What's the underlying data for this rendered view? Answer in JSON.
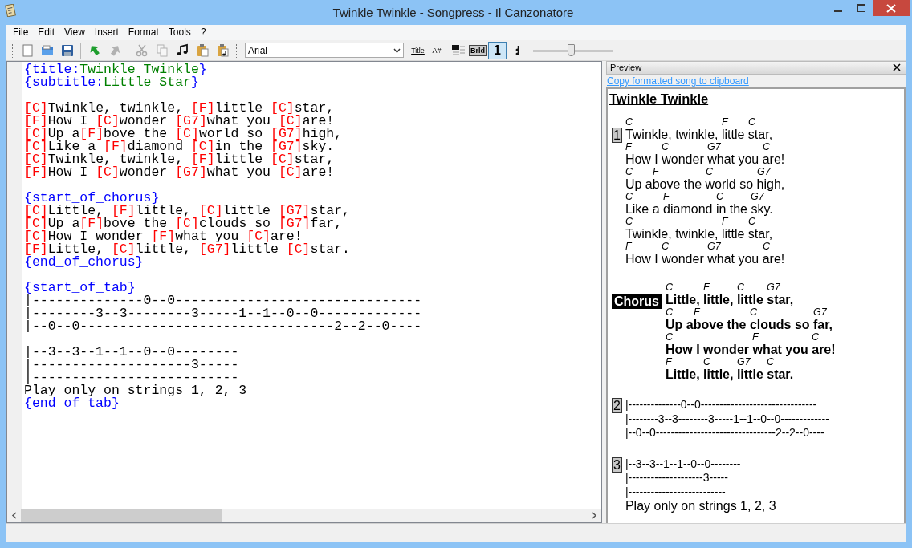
{
  "window": {
    "title": "Twinkle Twinkle - Songpress - Il Canzonatore"
  },
  "menu": [
    "File",
    "Edit",
    "View",
    "Insert",
    "Format",
    "Tools",
    "?"
  ],
  "toolbar": {
    "file_tools": [
      {
        "disabled": false
      },
      {
        "disabled": false
      },
      {
        "disabled": false
      }
    ],
    "edit_tools": [
      {
        "disabled": false
      },
      {
        "disabled": true
      },
      {
        "disabled": true
      },
      {
        "disabled": true
      },
      {
        "disabled": false
      },
      {
        "disabled": false
      },
      {
        "disabled": false
      }
    ],
    "font_field": {
      "value": "Arial"
    },
    "format_tools": [
      {
        "label": "Title",
        "disabled": false,
        "selected": false
      },
      {
        "label": "A#-",
        "disabled": false,
        "selected": false
      },
      {
        "disabled": false,
        "selected": false
      },
      {
        "label": "Brld",
        "disabled": false,
        "selected": false
      },
      {
        "label": "1",
        "disabled": false,
        "selected": true
      },
      {
        "disabled": false,
        "selected": false
      }
    ],
    "zoom": {
      "level": 0.47
    }
  },
  "editor": {
    "blocks": [
      [
        [
          {
            "kind": "directive",
            "text": "{title:"
          },
          {
            "kind": "value",
            "text": "Twinkle Twinkle"
          },
          {
            "kind": "directive",
            "text": "}"
          }
        ],
        [
          {
            "kind": "directive",
            "text": "{subtitle:"
          },
          {
            "kind": "value",
            "text": "Little Star"
          },
          {
            "kind": "directive",
            "text": "}"
          }
        ]
      ],
      [
        [
          {
            "kind": "chord",
            "text": "[C]"
          },
          {
            "kind": "text",
            "text": "Twinkle, twinkle, "
          },
          {
            "kind": "chord",
            "text": "[F]"
          },
          {
            "kind": "text",
            "text": "little "
          },
          {
            "kind": "chord",
            "text": "[C]"
          },
          {
            "kind": "text",
            "text": "star,"
          }
        ],
        [
          {
            "kind": "chord",
            "text": "[F]"
          },
          {
            "kind": "text",
            "text": "How I "
          },
          {
            "kind": "chord",
            "text": "[C]"
          },
          {
            "kind": "text",
            "text": "wonder "
          },
          {
            "kind": "chord",
            "text": "[G7]"
          },
          {
            "kind": "text",
            "text": "what you "
          },
          {
            "kind": "chord",
            "text": "[C]"
          },
          {
            "kind": "text",
            "text": "are!"
          }
        ],
        [
          {
            "kind": "chord",
            "text": "[C]"
          },
          {
            "kind": "text",
            "text": "Up a"
          },
          {
            "kind": "chord",
            "text": "[F]"
          },
          {
            "kind": "text",
            "text": "bove the "
          },
          {
            "kind": "chord",
            "text": "[C]"
          },
          {
            "kind": "text",
            "text": "world so "
          },
          {
            "kind": "chord",
            "text": "[G7]"
          },
          {
            "kind": "text",
            "text": "high,"
          }
        ],
        [
          {
            "kind": "chord",
            "text": "[C]"
          },
          {
            "kind": "text",
            "text": "Like a "
          },
          {
            "kind": "chord",
            "text": "[F]"
          },
          {
            "kind": "text",
            "text": "diamond "
          },
          {
            "kind": "chord",
            "text": "[C]"
          },
          {
            "kind": "text",
            "text": "in the "
          },
          {
            "kind": "chord",
            "text": "[G7]"
          },
          {
            "kind": "text",
            "text": "sky."
          }
        ],
        [
          {
            "kind": "chord",
            "text": "[C]"
          },
          {
            "kind": "text",
            "text": "Twinkle, twinkle, "
          },
          {
            "kind": "chord",
            "text": "[F]"
          },
          {
            "kind": "text",
            "text": "little "
          },
          {
            "kind": "chord",
            "text": "[C]"
          },
          {
            "kind": "text",
            "text": "star,"
          }
        ],
        [
          {
            "kind": "chord",
            "text": "[F]"
          },
          {
            "kind": "text",
            "text": "How I "
          },
          {
            "kind": "chord",
            "text": "[C]"
          },
          {
            "kind": "text",
            "text": "wonder "
          },
          {
            "kind": "chord",
            "text": "[G7]"
          },
          {
            "kind": "text",
            "text": "what you "
          },
          {
            "kind": "chord",
            "text": "[C]"
          },
          {
            "kind": "text",
            "text": "are!"
          }
        ]
      ],
      [
        [
          {
            "kind": "directive",
            "text": "{start_of_chorus}"
          }
        ],
        [
          {
            "kind": "chord",
            "text": "[C]"
          },
          {
            "kind": "text",
            "text": "Little, "
          },
          {
            "kind": "chord",
            "text": "[F]"
          },
          {
            "kind": "text",
            "text": "little, "
          },
          {
            "kind": "chord",
            "text": "[C]"
          },
          {
            "kind": "text",
            "text": "little "
          },
          {
            "kind": "chord",
            "text": "[G7]"
          },
          {
            "kind": "text",
            "text": "star,"
          }
        ],
        [
          {
            "kind": "chord",
            "text": "[C]"
          },
          {
            "kind": "text",
            "text": "Up a"
          },
          {
            "kind": "chord",
            "text": "[F]"
          },
          {
            "kind": "text",
            "text": "bove the "
          },
          {
            "kind": "chord",
            "text": "[C]"
          },
          {
            "kind": "text",
            "text": "clouds so "
          },
          {
            "kind": "chord",
            "text": "[G7]"
          },
          {
            "kind": "text",
            "text": "far,"
          }
        ],
        [
          {
            "kind": "chord",
            "text": "[C]"
          },
          {
            "kind": "text",
            "text": "How I wonder "
          },
          {
            "kind": "chord",
            "text": "[F]"
          },
          {
            "kind": "text",
            "text": "what you "
          },
          {
            "kind": "chord",
            "text": "[C]"
          },
          {
            "kind": "text",
            "text": "are!"
          }
        ],
        [
          {
            "kind": "chord",
            "text": "[F]"
          },
          {
            "kind": "text",
            "text": "Little, "
          },
          {
            "kind": "chord",
            "text": "[C]"
          },
          {
            "kind": "text",
            "text": "little, "
          },
          {
            "kind": "chord",
            "text": "[G7]"
          },
          {
            "kind": "text",
            "text": "little "
          },
          {
            "kind": "chord",
            "text": "[C]"
          },
          {
            "kind": "text",
            "text": "star."
          }
        ],
        [
          {
            "kind": "directive",
            "text": "{end_of_chorus}"
          }
        ]
      ],
      [
        [
          {
            "kind": "directive",
            "text": "{start_of_tab}"
          }
        ],
        [
          {
            "kind": "text",
            "text": "|--------------0--0-------------------------------"
          }
        ],
        [
          {
            "kind": "text",
            "text": "|--------3--3--------3-----1--1--0--0-------------"
          }
        ],
        [
          {
            "kind": "text",
            "text": "|--0--0--------------------------------2--2--0----"
          }
        ]
      ],
      [
        [
          {
            "kind": "text",
            "text": "|--3--3--1--1--0--0--------"
          }
        ],
        [
          {
            "kind": "text",
            "text": "|--------------------3-----"
          }
        ],
        [
          {
            "kind": "text",
            "text": "|--------------------------"
          }
        ],
        [
          {
            "kind": "text",
            "text": "Play only on strings 1, 2, 3"
          }
        ],
        [
          {
            "kind": "directive",
            "text": "{end_of_tab}"
          }
        ]
      ]
    ]
  },
  "preview": {
    "header": "Preview",
    "link": "Copy formatted song to clipboard",
    "song_title": "Twinkle Twinkle",
    "sections": [
      {
        "kind": "verse",
        "label": "1",
        "lines": [
          [
            {
              "chord": "C",
              "text": "Twinkle, twinkle, "
            },
            {
              "chord": "F",
              "text": "little "
            },
            {
              "chord": "C",
              "text": "star,"
            }
          ],
          [
            {
              "chord": "F",
              "text": "How I "
            },
            {
              "chord": "C",
              "text": "wonder "
            },
            {
              "chord": "G7",
              "text": "what you "
            },
            {
              "chord": "C",
              "text": "are!"
            }
          ],
          [
            {
              "chord": "C",
              "text": "Up a"
            },
            {
              "chord": "F",
              "text": "bove the "
            },
            {
              "chord": "C",
              "text": "world so "
            },
            {
              "chord": "G7",
              "text": "high,"
            }
          ],
          [
            {
              "chord": "C",
              "text": "Like a "
            },
            {
              "chord": "F",
              "text": "diamond "
            },
            {
              "chord": "C",
              "text": "in the "
            },
            {
              "chord": "G7",
              "text": "sky."
            }
          ],
          [
            {
              "chord": "C",
              "text": "Twinkle, twinkle, "
            },
            {
              "chord": "F",
              "text": "little "
            },
            {
              "chord": "C",
              "text": "star,"
            }
          ],
          [
            {
              "chord": "F",
              "text": "How I "
            },
            {
              "chord": "C",
              "text": "wonder "
            },
            {
              "chord": "G7",
              "text": "what you "
            },
            {
              "chord": "C",
              "text": "are!"
            }
          ]
        ]
      },
      {
        "kind": "chorus",
        "label": "Chorus",
        "lines": [
          [
            {
              "chord": "C",
              "text": "Little, "
            },
            {
              "chord": "F",
              "text": "little, "
            },
            {
              "chord": "C",
              "text": "little "
            },
            {
              "chord": "G7",
              "text": "star,"
            }
          ],
          [
            {
              "chord": "C",
              "text": "Up a"
            },
            {
              "chord": "F",
              "text": "bove the "
            },
            {
              "chord": "C",
              "text": "clouds so "
            },
            {
              "chord": "G7",
              "text": "far,"
            }
          ],
          [
            {
              "chord": "C",
              "text": "How I wonder "
            },
            {
              "chord": "F",
              "text": "what you "
            },
            {
              "chord": "C",
              "text": "are!"
            }
          ],
          [
            {
              "chord": "F",
              "text": "Little, "
            },
            {
              "chord": "C",
              "text": "little, "
            },
            {
              "chord": "G7",
              "text": "little "
            },
            {
              "chord": "C",
              "text": "star."
            }
          ]
        ]
      },
      {
        "kind": "tab",
        "label": "2",
        "lines": [
          "|--------------0--0-------------------------------",
          "|--------3--3--------3-----1--1--0--0-------------",
          "|--0--0--------------------------------2--2--0----"
        ]
      },
      {
        "kind": "tab",
        "label": "3",
        "lines": [
          "|--3--3--1--1--0--0--------",
          "|--------------------3-----",
          "|--------------------------",
          "Play only on strings 1, 2, 3"
        ]
      }
    ]
  }
}
